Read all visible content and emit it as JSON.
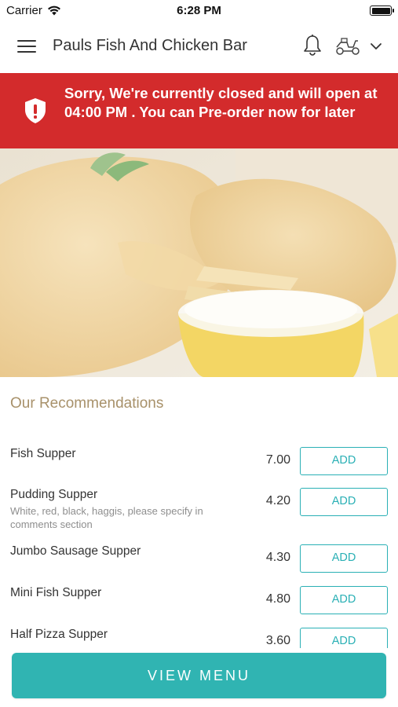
{
  "status_bar": {
    "carrier": "Carrier",
    "time": "6:28 PM",
    "wifi_icon": "wifi-icon",
    "battery_icon": "battery-icon"
  },
  "header": {
    "title": "Pauls Fish And Chicken Bar",
    "menu_icon": "hamburger-menu-icon",
    "bell_icon": "bell-icon",
    "delivery_icon": "scooter-icon",
    "dropdown_icon": "chevron-down-icon"
  },
  "banner": {
    "message": "Sorry, We're currently closed and will open at 04:00 PM . You can Pre-order now for later",
    "icon": "shield-alert-icon",
    "color": "#d32b2c"
  },
  "recommendations": {
    "title": "Our Recommendations",
    "add_label": "ADD",
    "items": [
      {
        "name": "Fish Supper",
        "description": "",
        "price": "7.00"
      },
      {
        "name": "Pudding Supper",
        "description": "White, red, black, haggis, please specify in comments section",
        "price": "4.20"
      },
      {
        "name": "Jumbo Sausage Supper",
        "description": "",
        "price": "4.30"
      },
      {
        "name": "Mini Fish Supper",
        "description": "",
        "price": "4.80"
      },
      {
        "name": "Half Pizza Supper",
        "description": "",
        "price": "3.60"
      }
    ]
  },
  "footer": {
    "view_menu_label": "VIEW MENU",
    "accent_color": "#30b4b2"
  }
}
